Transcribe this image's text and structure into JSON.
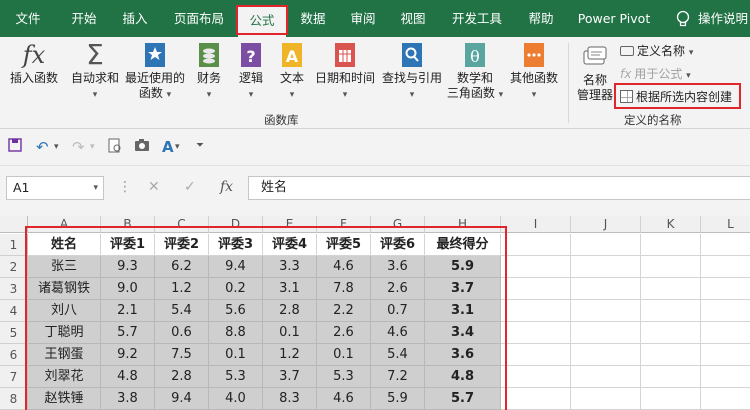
{
  "tabs": [
    "文件",
    "开始",
    "插入",
    "页面布局",
    "公式",
    "数据",
    "审阅",
    "视图",
    "开发工具",
    "帮助",
    "Power Pivot",
    "操作说明"
  ],
  "ribbon": {
    "insert_function": "插入函数",
    "autosum": "自动求和",
    "recent_line1": "最近使用的",
    "recent_line2": "函数",
    "finance": "财务",
    "logic": "逻辑",
    "text": "文本",
    "datetime": "日期和时间",
    "lookup": "查找与引用",
    "math_line1": "数学和",
    "math_line2": "三角函数",
    "other": "其他函数",
    "group_library": "函数库",
    "name_mgr_line1": "名称",
    "name_mgr_line2": "管理器",
    "define_name": "定义名称",
    "use_in_formula": "用于公式",
    "create_from_selection": "根据所选内容创建",
    "group_defined_names": "定义的名称"
  },
  "formula_bar": {
    "name_box": "A1",
    "content": "姓名"
  },
  "grid": {
    "columns": [
      "A",
      "B",
      "C",
      "D",
      "E",
      "F",
      "G",
      "H",
      "I",
      "J",
      "K",
      "L"
    ],
    "rows": [
      "1",
      "2",
      "3",
      "4",
      "5",
      "6",
      "7",
      "8"
    ],
    "data": [
      [
        "姓名",
        "评委1",
        "评委2",
        "评委3",
        "评委4",
        "评委5",
        "评委6",
        "最终得分"
      ],
      [
        "张三",
        "9.3",
        "6.2",
        "9.4",
        "3.3",
        "4.6",
        "3.6",
        "5.9"
      ],
      [
        "诸葛钢铁",
        "9.0",
        "1.2",
        "0.2",
        "3.1",
        "7.8",
        "2.6",
        "3.7"
      ],
      [
        "刘八",
        "2.1",
        "5.4",
        "5.6",
        "2.8",
        "2.2",
        "0.7",
        "3.1"
      ],
      [
        "丁聪明",
        "5.7",
        "0.6",
        "8.8",
        "0.1",
        "2.6",
        "4.6",
        "3.4"
      ],
      [
        "王钢蛋",
        "9.2",
        "7.5",
        "0.1",
        "1.2",
        "0.1",
        "5.4",
        "3.6"
      ],
      [
        "刘翠花",
        "4.8",
        "2.8",
        "5.3",
        "3.7",
        "5.3",
        "7.2",
        "4.8"
      ],
      [
        "赵铁锤",
        "3.8",
        "9.4",
        "4.0",
        "8.3",
        "4.6",
        "5.9",
        "5.7"
      ]
    ]
  }
}
